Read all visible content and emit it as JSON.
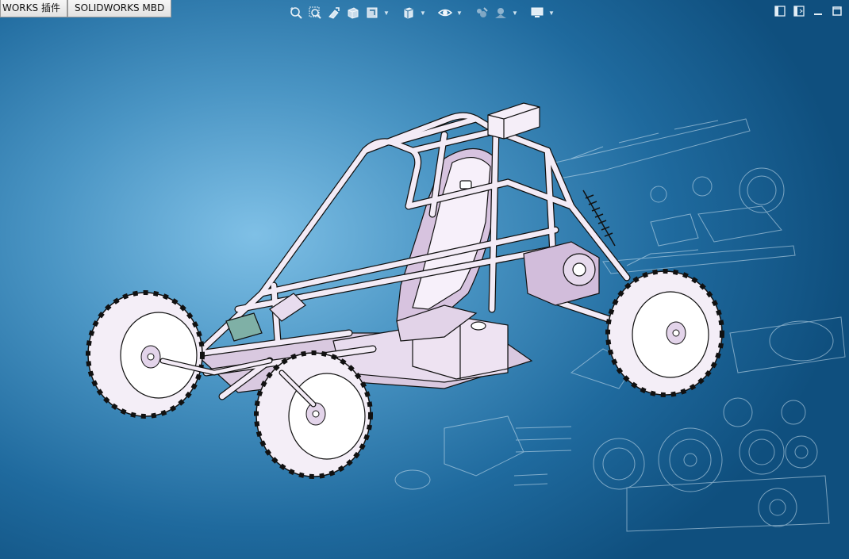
{
  "tabs": [
    {
      "label": "WORKS 插件"
    },
    {
      "label": "SOLIDWORKS MBD"
    }
  ],
  "heads_up_toolbar": {
    "icons": [
      "zoom-to-fit-icon",
      "zoom-to-area-icon",
      "previous-view-icon",
      "section-view-icon",
      "view-orientation-icon",
      "display-style-icon",
      "hide-show-items-icon",
      "edit-appearance-icon",
      "apply-scene-icon",
      "view-settings-icon"
    ]
  },
  "window_controls": {
    "icons": [
      "split-view-left-icon",
      "split-view-right-icon",
      "restore-icon",
      "maximize-icon"
    ]
  },
  "colors": {
    "background_center": "#7fc0e6",
    "background_edge": "#0f4f7e",
    "model_fill": "#f0e6f3",
    "model_shade": "#c9b3d3",
    "model_line": "#111111",
    "blueprint_line": "#bcd8ec"
  },
  "model": {
    "type": "off-road buggy assembly"
  }
}
